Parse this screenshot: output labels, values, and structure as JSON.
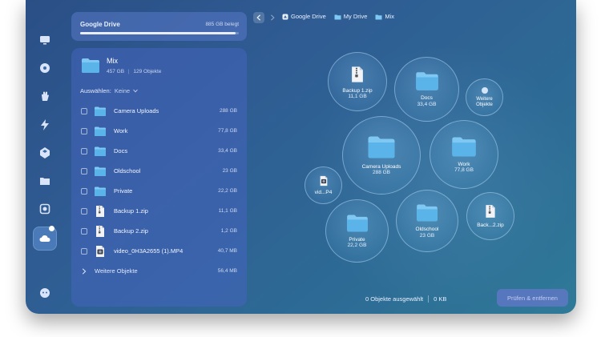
{
  "storage": {
    "name": "Google Drive",
    "used_label": "885 GB belegt",
    "used_fraction": 0.98
  },
  "sidebar": {
    "items": [
      {
        "icon": "monitor-icon"
      },
      {
        "icon": "disk-icon"
      },
      {
        "icon": "hand-icon"
      },
      {
        "icon": "lightning-icon"
      },
      {
        "icon": "apps-icon"
      },
      {
        "icon": "folder-icon"
      },
      {
        "icon": "scanner-icon"
      },
      {
        "icon": "cloud-icon"
      },
      {
        "icon": "assistant-icon"
      }
    ]
  },
  "panel": {
    "title": "Mix",
    "size": "457 GB",
    "count": "129 Objekte",
    "select_label": "Auswählen:",
    "select_value": "Keine",
    "items": [
      {
        "name": "Camera Uploads",
        "size": "288 GB",
        "icon": "folder"
      },
      {
        "name": "Work",
        "size": "77,8 GB",
        "icon": "folder"
      },
      {
        "name": "Docs",
        "size": "33,4 GB",
        "icon": "folder"
      },
      {
        "name": "Oldschool",
        "size": "23 GB",
        "icon": "folder"
      },
      {
        "name": "Private",
        "size": "22,2 GB",
        "icon": "folder"
      },
      {
        "name": "Backup 1.zip",
        "size": "11,1 GB",
        "icon": "zip"
      },
      {
        "name": "Backup 2.zip",
        "size": "1,2 GB",
        "icon": "zip"
      },
      {
        "name": "video_0H3A2655 (1).MP4",
        "size": "40,7 MB",
        "icon": "video"
      }
    ],
    "more_label": "Weitere Objekte",
    "more_size": "56,4 MB"
  },
  "breadcrumb": [
    "Google Drive",
    "My Drive",
    "Mix"
  ],
  "bubbles": [
    {
      "name": "Backup 1.zip",
      "size": "11,1 GB",
      "icon": "zip"
    },
    {
      "name": "Docs",
      "size": "33,4 GB",
      "icon": "folder"
    },
    {
      "name": "Weitere Objekte",
      "size": "",
      "icon": "dot"
    },
    {
      "name": "Camera Uploads",
      "size": "288 GB",
      "icon": "folder"
    },
    {
      "name": "Work",
      "size": "77,8 GB",
      "icon": "folder"
    },
    {
      "name": "vid...P4",
      "size": "",
      "icon": "video"
    },
    {
      "name": "Private",
      "size": "22,2 GB",
      "icon": "folder"
    },
    {
      "name": "Oldschool",
      "size": "23 GB",
      "icon": "folder"
    },
    {
      "name": "Back...2.zip",
      "size": "",
      "icon": "zip"
    }
  ],
  "footer": {
    "selected": "0 Objekte ausgewählt",
    "selected_size": "0 KB",
    "action": "Prüfen & entfernen"
  }
}
